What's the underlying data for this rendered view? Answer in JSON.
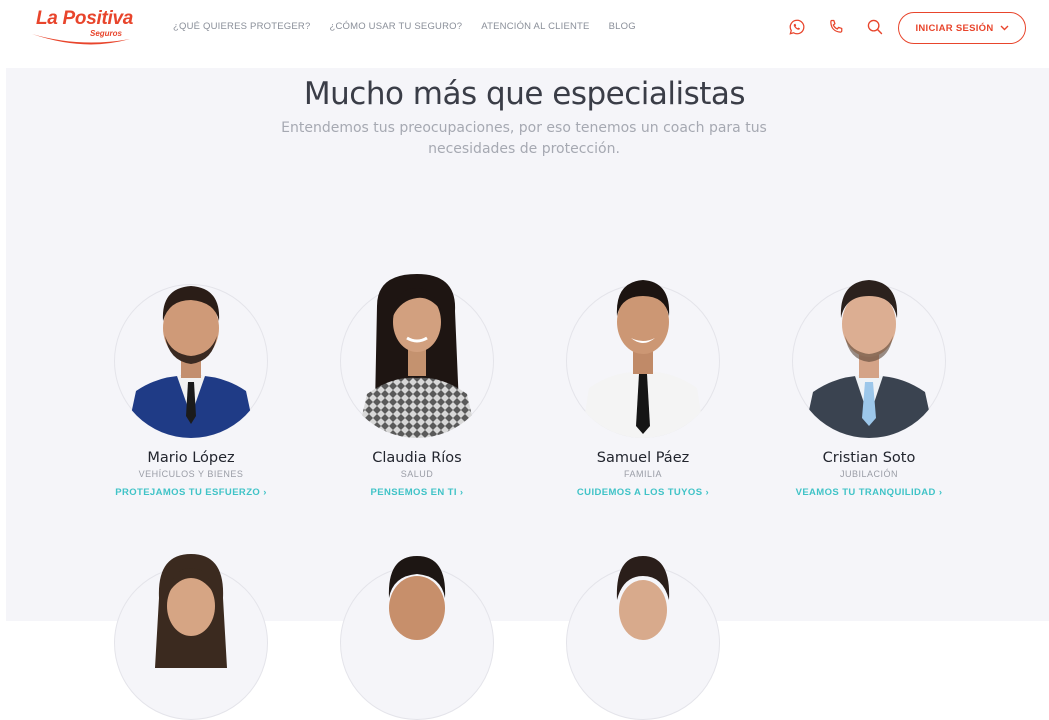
{
  "brand": {
    "name": "La Positiva",
    "sub": "Seguros",
    "accent": "#e8452c",
    "link_color": "#40c3c7"
  },
  "nav": {
    "items": [
      "¿QUÉ QUIERES PROTEGER?",
      "¿CÓMO USAR TU SEGURO?",
      "ATENCIÓN AL CLIENTE",
      "BLOG"
    ]
  },
  "header_icons": [
    "whatsapp-icon",
    "phone-icon",
    "search-icon"
  ],
  "login": {
    "label": "INICIAR SESIÓN"
  },
  "hero": {
    "title": "Mucho más que especialistas",
    "subtitle": "Entendemos tus preocupaciones, por eso tenemos un coach para tus necesidades de protección."
  },
  "coaches": [
    {
      "name": "Mario López",
      "area": "VEHÍCULOS Y BIENES",
      "link": "PROTEJAMOS TU ESFUERZO ›"
    },
    {
      "name": "Claudia Ríos",
      "area": "SALUD",
      "link": "PENSEMOS EN TI ›"
    },
    {
      "name": "Samuel Páez",
      "area": "FAMILIA",
      "link": "CUIDEMOS A LOS TUYOS ›"
    },
    {
      "name": "Cristian Soto",
      "area": "JUBILACIÓN",
      "link": "VEAMOS TU TRANQUILIDAD ›"
    }
  ]
}
